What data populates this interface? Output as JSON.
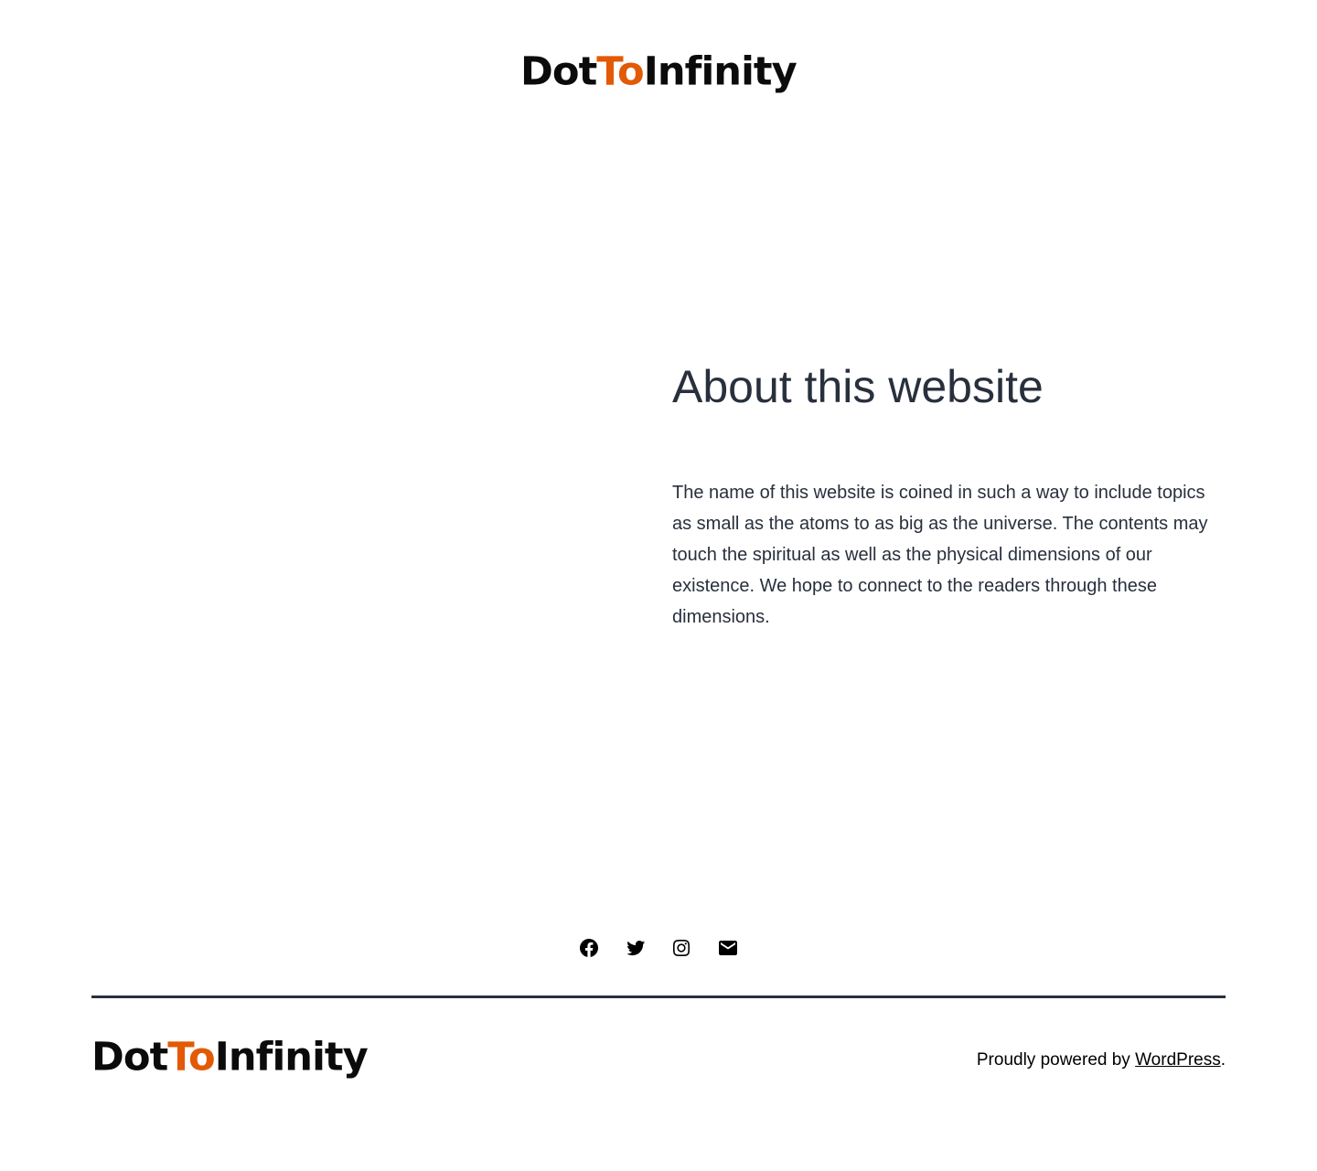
{
  "header": {
    "logo": {
      "part1": "Dot",
      "part2": "To",
      "part3": "Infinity"
    }
  },
  "about": {
    "title": "About this website",
    "paragraph": "The name of this website is coined in such a way to include topics as small as the atoms to as big as the universe. The contents may touch the spiritual as well as the physical dimensions of our existence. We hope to connect to the readers through these dimensions."
  },
  "social": {
    "icons": [
      "facebook-icon",
      "twitter-icon",
      "instagram-icon",
      "email-icon"
    ]
  },
  "footer": {
    "logo": {
      "part1": "Dot",
      "part2": "To",
      "part3": "Infinity"
    },
    "powered_prefix": "Proudly powered by ",
    "powered_link": "WordPress",
    "powered_suffix": "."
  },
  "colors": {
    "accent": "#e25a05",
    "text": "#28303d",
    "logo_dark": "#0b0b0b",
    "background": "#ffffff"
  }
}
